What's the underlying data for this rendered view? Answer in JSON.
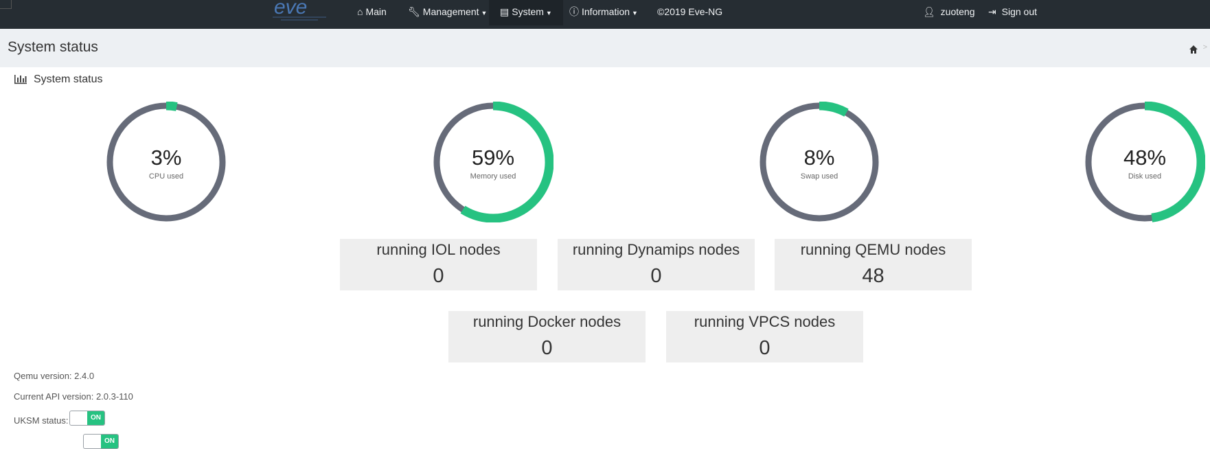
{
  "navbar": {
    "brand": "eve",
    "main": "Main",
    "management": "Management",
    "system": "System",
    "information": "Information",
    "copyright": "©2019 Eve-NG",
    "user": "zuoteng",
    "signout": "Sign out"
  },
  "page": {
    "title": "System status"
  },
  "panel": {
    "title": "System status"
  },
  "gauges": [
    {
      "value_text": "3%",
      "label": "CPU used",
      "value": 3
    },
    {
      "value_text": "59%",
      "label": "Memory used",
      "value": 59
    },
    {
      "value_text": "8%",
      "label": "Swap used",
      "value": 8
    },
    {
      "value_text": "48%",
      "label": "Disk used",
      "value": 48
    }
  ],
  "nodes": [
    {
      "label": "running IOL nodes",
      "count": "0"
    },
    {
      "label": "running Dynamips nodes",
      "count": "0"
    },
    {
      "label": "running QEMU nodes",
      "count": "48"
    },
    {
      "label": "running Docker nodes",
      "count": "0"
    },
    {
      "label": "running VPCS nodes",
      "count": "0"
    }
  ],
  "info": {
    "qemu_version": "Qemu version: 2.4.0",
    "api_version": "Current API version: 2.0.3-110",
    "uksm_status": "UKSM status:",
    "toggle_on": "ON"
  },
  "colors": {
    "navbar": "#262d33",
    "gauge_track": "#666b79",
    "gauge_fill": "#26c281",
    "header": "#edf0f3"
  }
}
